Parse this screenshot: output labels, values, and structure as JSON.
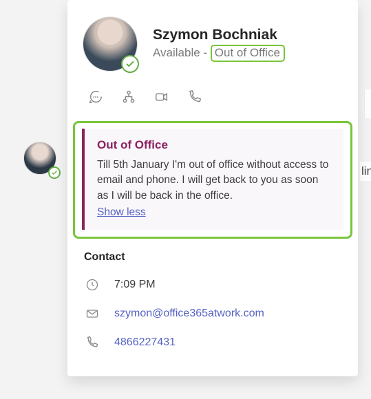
{
  "profile": {
    "name": "Szymon Bochniak",
    "status_prefix": "Available",
    "status_separator": " - ",
    "status_suffix": "Out of Office"
  },
  "presence": {
    "state": "available-out-of-office",
    "icon": "checkmark-circle"
  },
  "actions": {
    "chat": "Chat",
    "org": "Org chart",
    "video": "Video call",
    "call": "Audio call"
  },
  "ooo": {
    "title": "Out of Office",
    "message": "Till 5th January I'm out of office without access to email and phone. I will get back to you as soon as I will be back in the office.",
    "toggle": "Show less"
  },
  "contact": {
    "heading": "Contact",
    "time": "7:09 PM",
    "email": "szymon@office365atwork.com",
    "phone": "4866227431"
  },
  "edge_hint": "lin"
}
